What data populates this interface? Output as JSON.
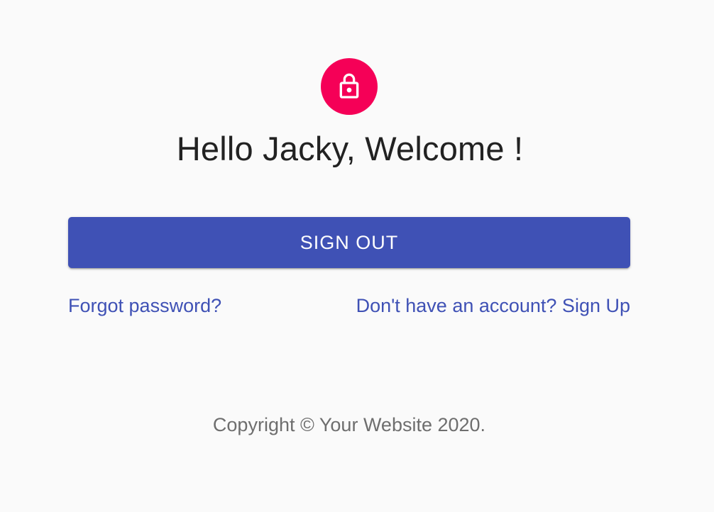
{
  "header": {
    "icon": "lock-icon",
    "title": "Hello Jacky, Welcome !"
  },
  "actions": {
    "sign_out_label": "SIGN OUT"
  },
  "links": {
    "forgot_password": "Forgot password?",
    "sign_up": "Don't have an account? Sign Up"
  },
  "footer": {
    "copyright": "Copyright © Your Website 2020."
  },
  "colors": {
    "avatar_bg": "#f50057",
    "primary": "#3f51b5",
    "background": "#fafafa",
    "title_text": "#222222",
    "footer_text": "#6e6e6e"
  }
}
